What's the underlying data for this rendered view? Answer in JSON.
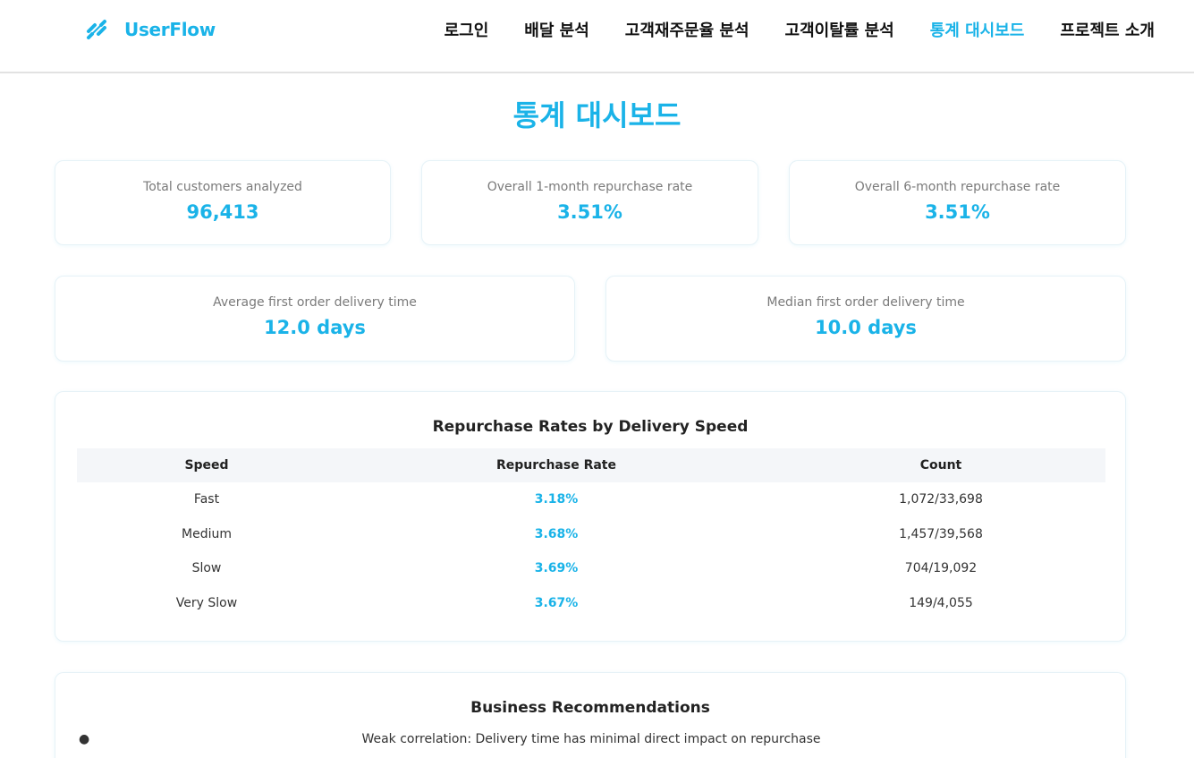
{
  "brand": {
    "name": "UserFlow",
    "icon": "link-icon",
    "color": "#1ab3e8"
  },
  "nav": {
    "items": [
      {
        "label": "로그인",
        "active": false
      },
      {
        "label": "배달 분석",
        "active": false
      },
      {
        "label": "고객재주문율 분석",
        "active": false
      },
      {
        "label": "고객이탈률 분석",
        "active": false
      },
      {
        "label": "통계 대시보드",
        "active": true
      },
      {
        "label": "프로젝트 소개",
        "active": false
      }
    ]
  },
  "page": {
    "title": "통계 대시보드"
  },
  "stats": [
    {
      "label": "Total customers analyzed",
      "value": "96,413"
    },
    {
      "label": "Overall 1-month repurchase rate",
      "value": "3.51%"
    },
    {
      "label": "Overall 6-month repurchase rate",
      "value": "3.51%"
    },
    {
      "label": "Average first order delivery time",
      "value": "12.0 days"
    },
    {
      "label": "Median first order delivery time",
      "value": "10.0 days"
    }
  ],
  "repurchase_table": {
    "title": "Repurchase Rates by Delivery Speed",
    "headers": [
      "Speed",
      "Repurchase Rate",
      "Count"
    ],
    "rows": [
      [
        "Fast",
        "3.18%",
        "1,072/33,698"
      ],
      [
        "Medium",
        "3.68%",
        "1,457/39,568"
      ],
      [
        "Slow",
        "3.69%",
        "704/19,092"
      ],
      [
        "Very Slow",
        "3.67%",
        "149/4,055"
      ]
    ]
  },
  "recommendations": {
    "title": "Business Recommendations",
    "items": [
      "Weak correlation: Delivery time has minimal direct impact on repurchase"
    ]
  }
}
